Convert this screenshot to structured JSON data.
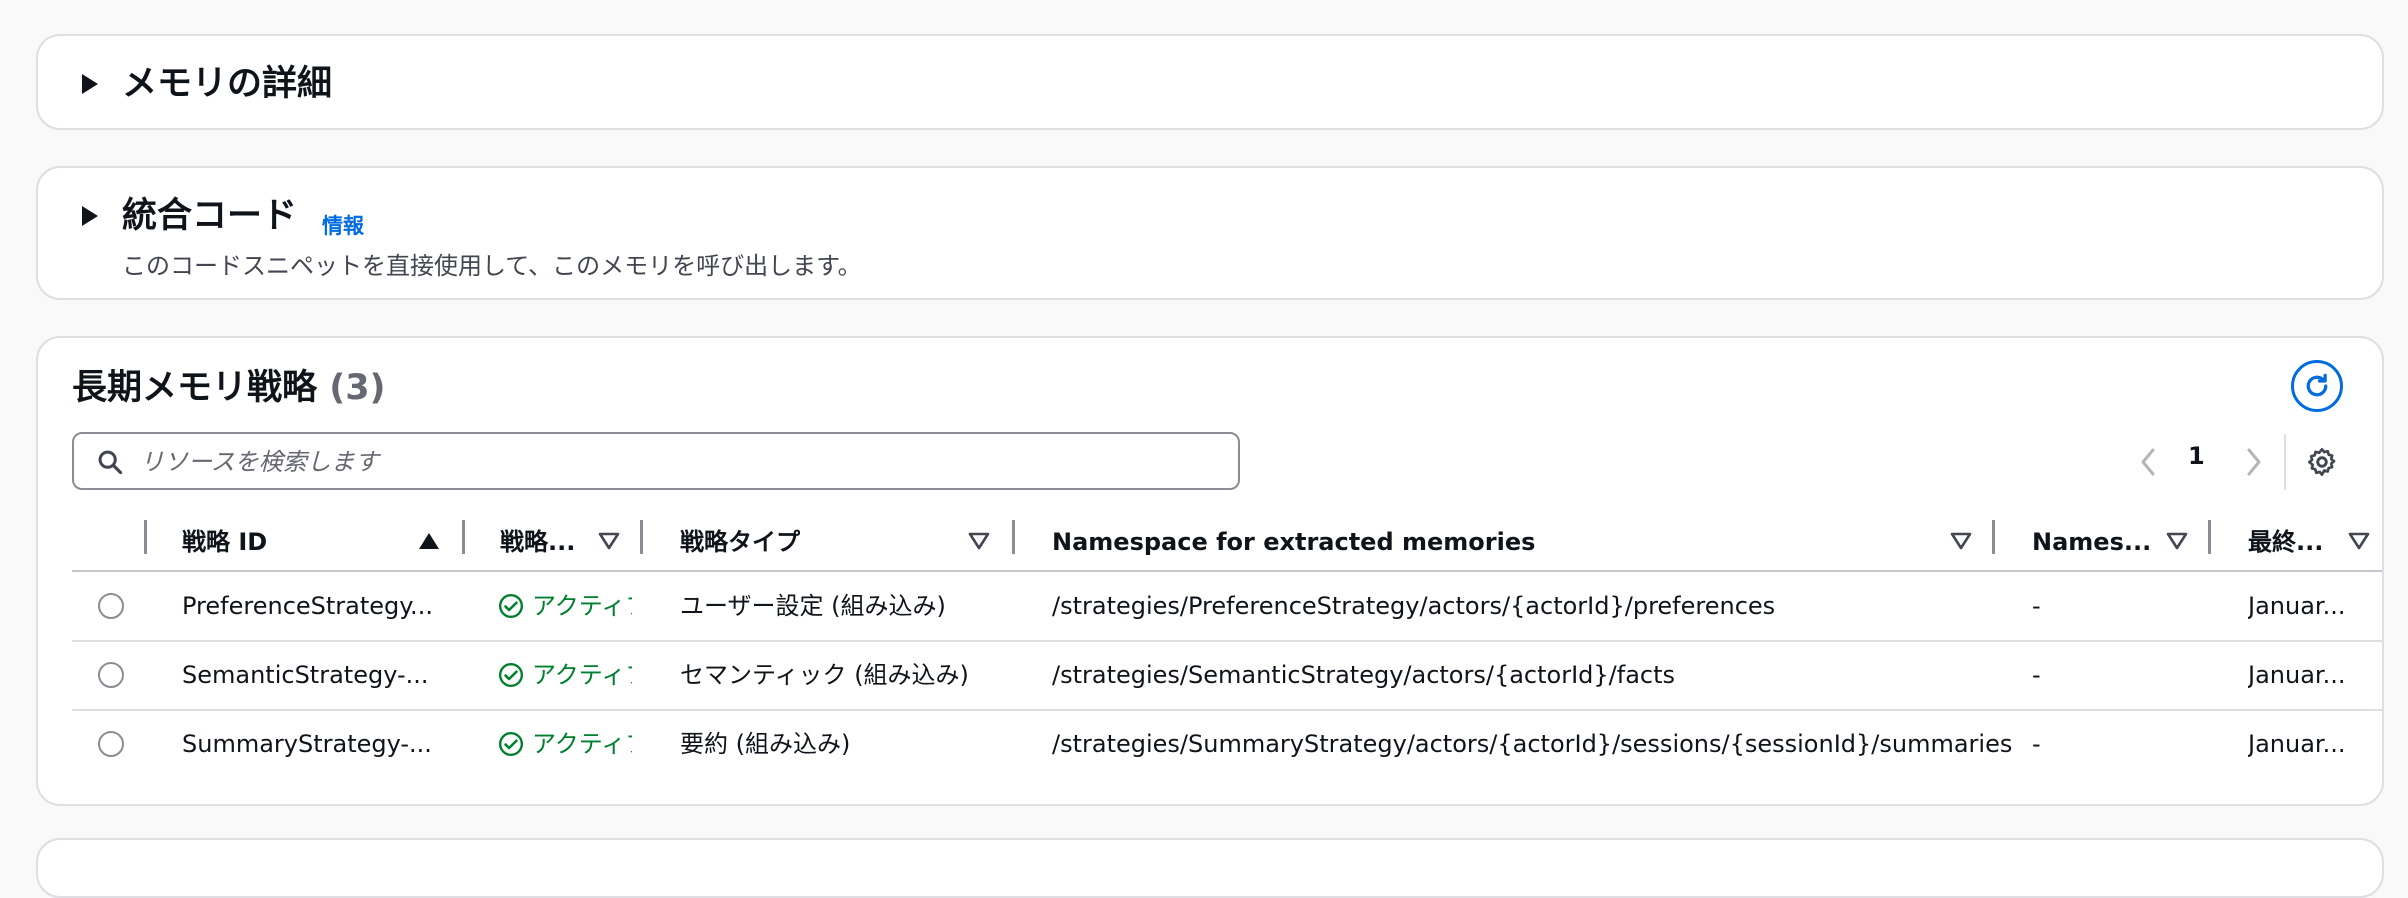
{
  "memory_details": {
    "title": "メモリの詳細"
  },
  "integration_code": {
    "title": "統合コード",
    "info_link": "情報",
    "description": "このコードスニペットを直接使用して、このメモリを呼び出します。"
  },
  "strategies": {
    "title": "長期メモリ戦略",
    "count": "(3)",
    "search_placeholder": "リソースを検索します",
    "pagination": {
      "current_page": "1"
    },
    "columns": [
      {
        "label": "戦略 ID",
        "sort": "ascending"
      },
      {
        "label": "戦略...",
        "sort": "none"
      },
      {
        "label": "戦略タイプ",
        "sort": "none"
      },
      {
        "label": "Namespace for extracted memories",
        "sort": "none"
      },
      {
        "label": "Names...",
        "sort": "none"
      },
      {
        "label": "最終...",
        "sort": "none"
      }
    ],
    "rows": [
      {
        "id": "PreferenceStrategy...",
        "status": "アクティブ",
        "type": "ユーザー設定 (組み込み)",
        "namespace": "/strategies/PreferenceStrategy/actors/{actorId}/preferences",
        "names": "-",
        "last": "Januar..."
      },
      {
        "id": "SemanticStrategy-...",
        "status": "アクティブ",
        "type": "セマンティック (組み込み)",
        "namespace": "/strategies/SemanticStrategy/actors/{actorId}/facts",
        "names": "-",
        "last": "Januar..."
      },
      {
        "id": "SummaryStrategy-...",
        "status": "アクティブ",
        "type": "要約 (組み込み)",
        "namespace": "/strategies/SummaryStrategy/actors/{actorId}/sessions/{sessionId}/summaries",
        "names": "-",
        "last": "Januar..."
      }
    ]
  },
  "colors": {
    "accent": "#006ce0",
    "success": "#00802f",
    "border": "#dedee3"
  }
}
